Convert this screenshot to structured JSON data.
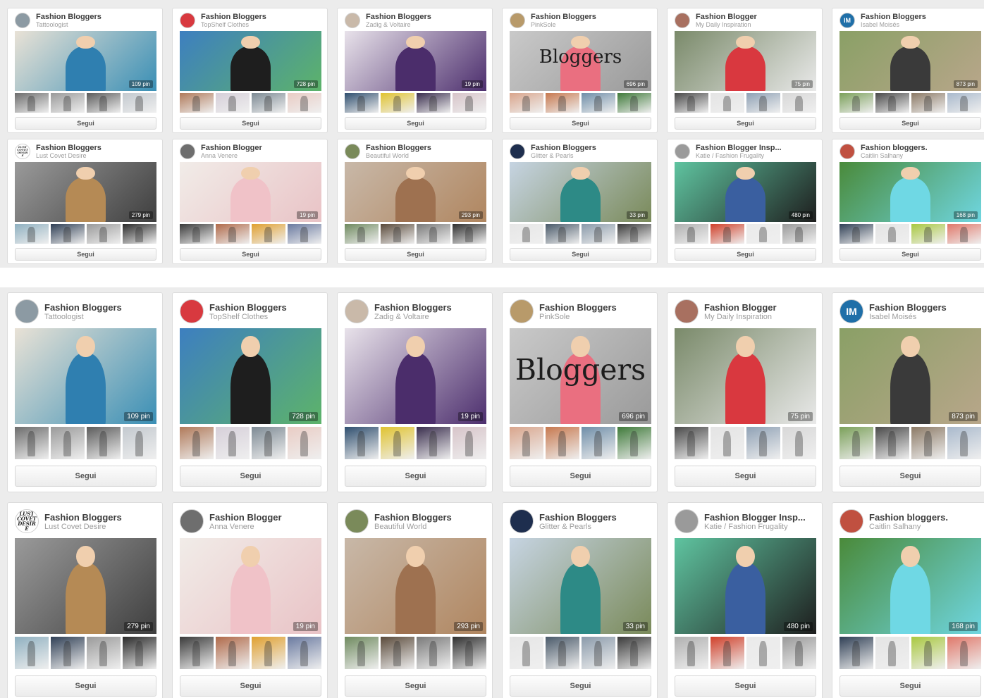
{
  "follow_label": "Segui",
  "boards": [
    {
      "title": "Fashion Bloggers",
      "subtitle": "Tattoologist",
      "pins": "109 pin",
      "avatar": "",
      "avatar_color": "#8c9aa3",
      "cover": [
        "#e9e2d6",
        "#3a8fb5"
      ],
      "figure": "#2f7fb0",
      "thumbs": [
        "#6d6d6d",
        "#9a9a9a",
        "#5c5c5c",
        "#c3c9cf"
      ]
    },
    {
      "title": "Fashion Bloggers",
      "subtitle": "TopShelf Clothes",
      "pins": "728 pin",
      "avatar": "",
      "avatar_color": "#d8393f",
      "cover": [
        "#3d7fc0",
        "#5db36a"
      ],
      "figure": "#1e1e1e",
      "thumbs": [
        "#b07a5a",
        "#d6cfd9",
        "#7d8a94",
        "#e9ccc4"
      ]
    },
    {
      "title": "Fashion Bloggers",
      "subtitle": "Zadig & Voltaire",
      "pins": "19 pin",
      "avatar": "",
      "avatar_color": "#c9b9a9",
      "cover": [
        "#e8e2ea",
        "#4d2f6e"
      ],
      "figure": "#4b2d6b",
      "thumbs": [
        "#2f4f6f",
        "#e0c330",
        "#3a2e4e",
        "#d7c4c9"
      ]
    },
    {
      "title": "Fashion Bloggers",
      "subtitle": "PinkSole",
      "pins": "696 pin",
      "avatar": "",
      "avatar_color": "#b89a6a",
      "cover": [
        "#c9c9c9",
        "#9a9a9a"
      ],
      "figure": "#ea6f80",
      "word": "Bloggers",
      "thumbs": [
        "#d9a58c",
        "#c7794f",
        "#6f8ea8",
        "#3f7a3a"
      ]
    },
    {
      "title": "Fashion Blogger",
      "subtitle": "My Daily Inspiration",
      "pins": "75 pin",
      "avatar": "",
      "avatar_color": "#a87060",
      "cover": [
        "#7a8a6a",
        "#e9e9e9"
      ],
      "figure": "#d9383f",
      "thumbs": [
        "#4a4a4a",
        "#e4e4e4",
        "#8fa1b5",
        "#d8d8d8"
      ]
    },
    {
      "title": "Fashion Bloggers",
      "subtitle": "Isabel Moisés",
      "pins": "873 pin",
      "avatar": "IM",
      "avatar_color": "#1f6fa8",
      "cover": [
        "#8aa066",
        "#b8a68a"
      ],
      "figure": "#3a3a3a",
      "thumbs": [
        "#7ba05a",
        "#4a4a4a",
        "#8c7a66",
        "#a9b9cc"
      ]
    },
    {
      "title": "Fashion Bloggers",
      "subtitle": "Lust Covet Desire",
      "pins": "279 pin",
      "avatar": "LUST COVET DESIRE",
      "avatar_color": "#ffffff",
      "cover": [
        "#9a9a9a",
        "#3f3f3f"
      ],
      "figure": "#b58a55",
      "thumbs": [
        "#8fb0c0",
        "#2f3f55",
        "#9a9a9a",
        "#2a2a2a"
      ]
    },
    {
      "title": "Fashion Blogger",
      "subtitle": "Anna Venere",
      "pins": "19 pin",
      "avatar": "",
      "avatar_color": "#6e6e6e",
      "cover": [
        "#f1ece8",
        "#e9c3c6"
      ],
      "figure": "#f0c2c8",
      "thumbs": [
        "#3a3a3a",
        "#b06a4a",
        "#e0a030",
        "#6a7aa0"
      ]
    },
    {
      "title": "Fashion Bloggers",
      "subtitle": "Beautiful World",
      "pins": "293 pin",
      "avatar": "",
      "avatar_color": "#7a8a5a",
      "cover": [
        "#c8b8a8",
        "#b08660"
      ],
      "figure": "#9e7150",
      "thumbs": [
        "#6f8a5f",
        "#5a4a3a",
        "#7a7a7a",
        "#2f2f2f"
      ]
    },
    {
      "title": "Fashion Bloggers",
      "subtitle": "Glitter & Pearls",
      "pins": "33 pin",
      "avatar": "",
      "avatar_color": "#1e2e4e",
      "cover": [
        "#c6d4e2",
        "#7a8a5a"
      ],
      "figure": "#2d8a86",
      "thumbs": [
        "#e6e6e6",
        "#4a5a6a",
        "#8a9aaa",
        "#3a3a3a"
      ]
    },
    {
      "title": "Fashion Blogger Insp...",
      "subtitle": "Katie / Fashion Frugality",
      "pins": "480 pin",
      "avatar": "",
      "avatar_color": "#9a9a9a",
      "cover": [
        "#5fc4a0",
        "#1e1e1e"
      ],
      "figure": "#3a5fa0",
      "thumbs": [
        "#b0b0b0",
        "#d0402a",
        "#eaeaea",
        "#9a9a9a"
      ]
    },
    {
      "title": "Fashion bloggers.",
      "subtitle": "Caitlin Salhany",
      "pins": "168 pin",
      "avatar": "",
      "avatar_color": "#c05040",
      "cover": [
        "#4a8a3a",
        "#6fd6e0"
      ],
      "figure": "#6fd8e4",
      "thumbs": [
        "#2f3f55",
        "#e4e4e4",
        "#a9c840",
        "#e0786a"
      ]
    }
  ]
}
